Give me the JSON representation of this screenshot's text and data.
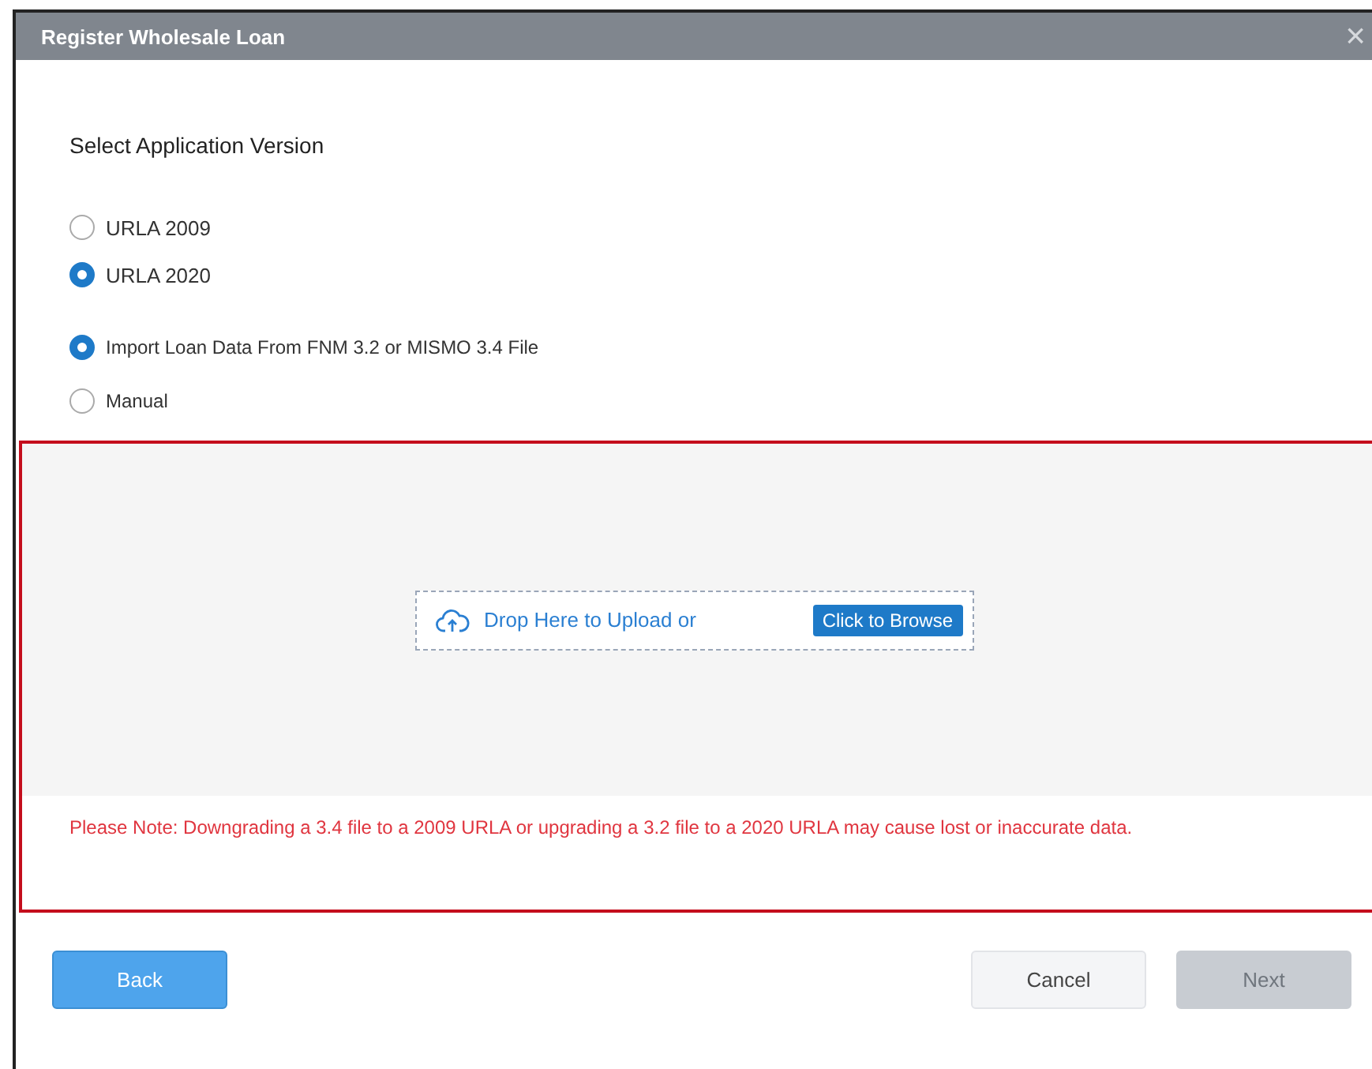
{
  "window": {
    "title": "Register Wholesale Loan",
    "close_icon": "×"
  },
  "heading": "Select Application Version",
  "version_options": [
    {
      "label": "URLA 2009",
      "selected": false
    },
    {
      "label": "URLA 2020",
      "selected": true
    }
  ],
  "source_options": [
    {
      "label": "Import Loan Data From FNM 3.2 or MISMO 3.4 File",
      "selected": true
    },
    {
      "label": "Manual",
      "selected": false
    }
  ],
  "upload": {
    "drop_text": "Drop Here to Upload or",
    "browse_button": "Click to Browse"
  },
  "note": "Please Note: Downgrading a 3.4 file to a 2009 URLA or upgrading a 3.2 file to a 2020 URLA may cause lost or inaccurate data.",
  "buttons": [
    {
      "label": "Back",
      "kind": "primary",
      "disabled": false
    },
    {
      "label": "Cancel",
      "kind": "secondary",
      "disabled": false
    },
    {
      "label": "Next",
      "kind": "primary",
      "disabled": true
    }
  ]
}
